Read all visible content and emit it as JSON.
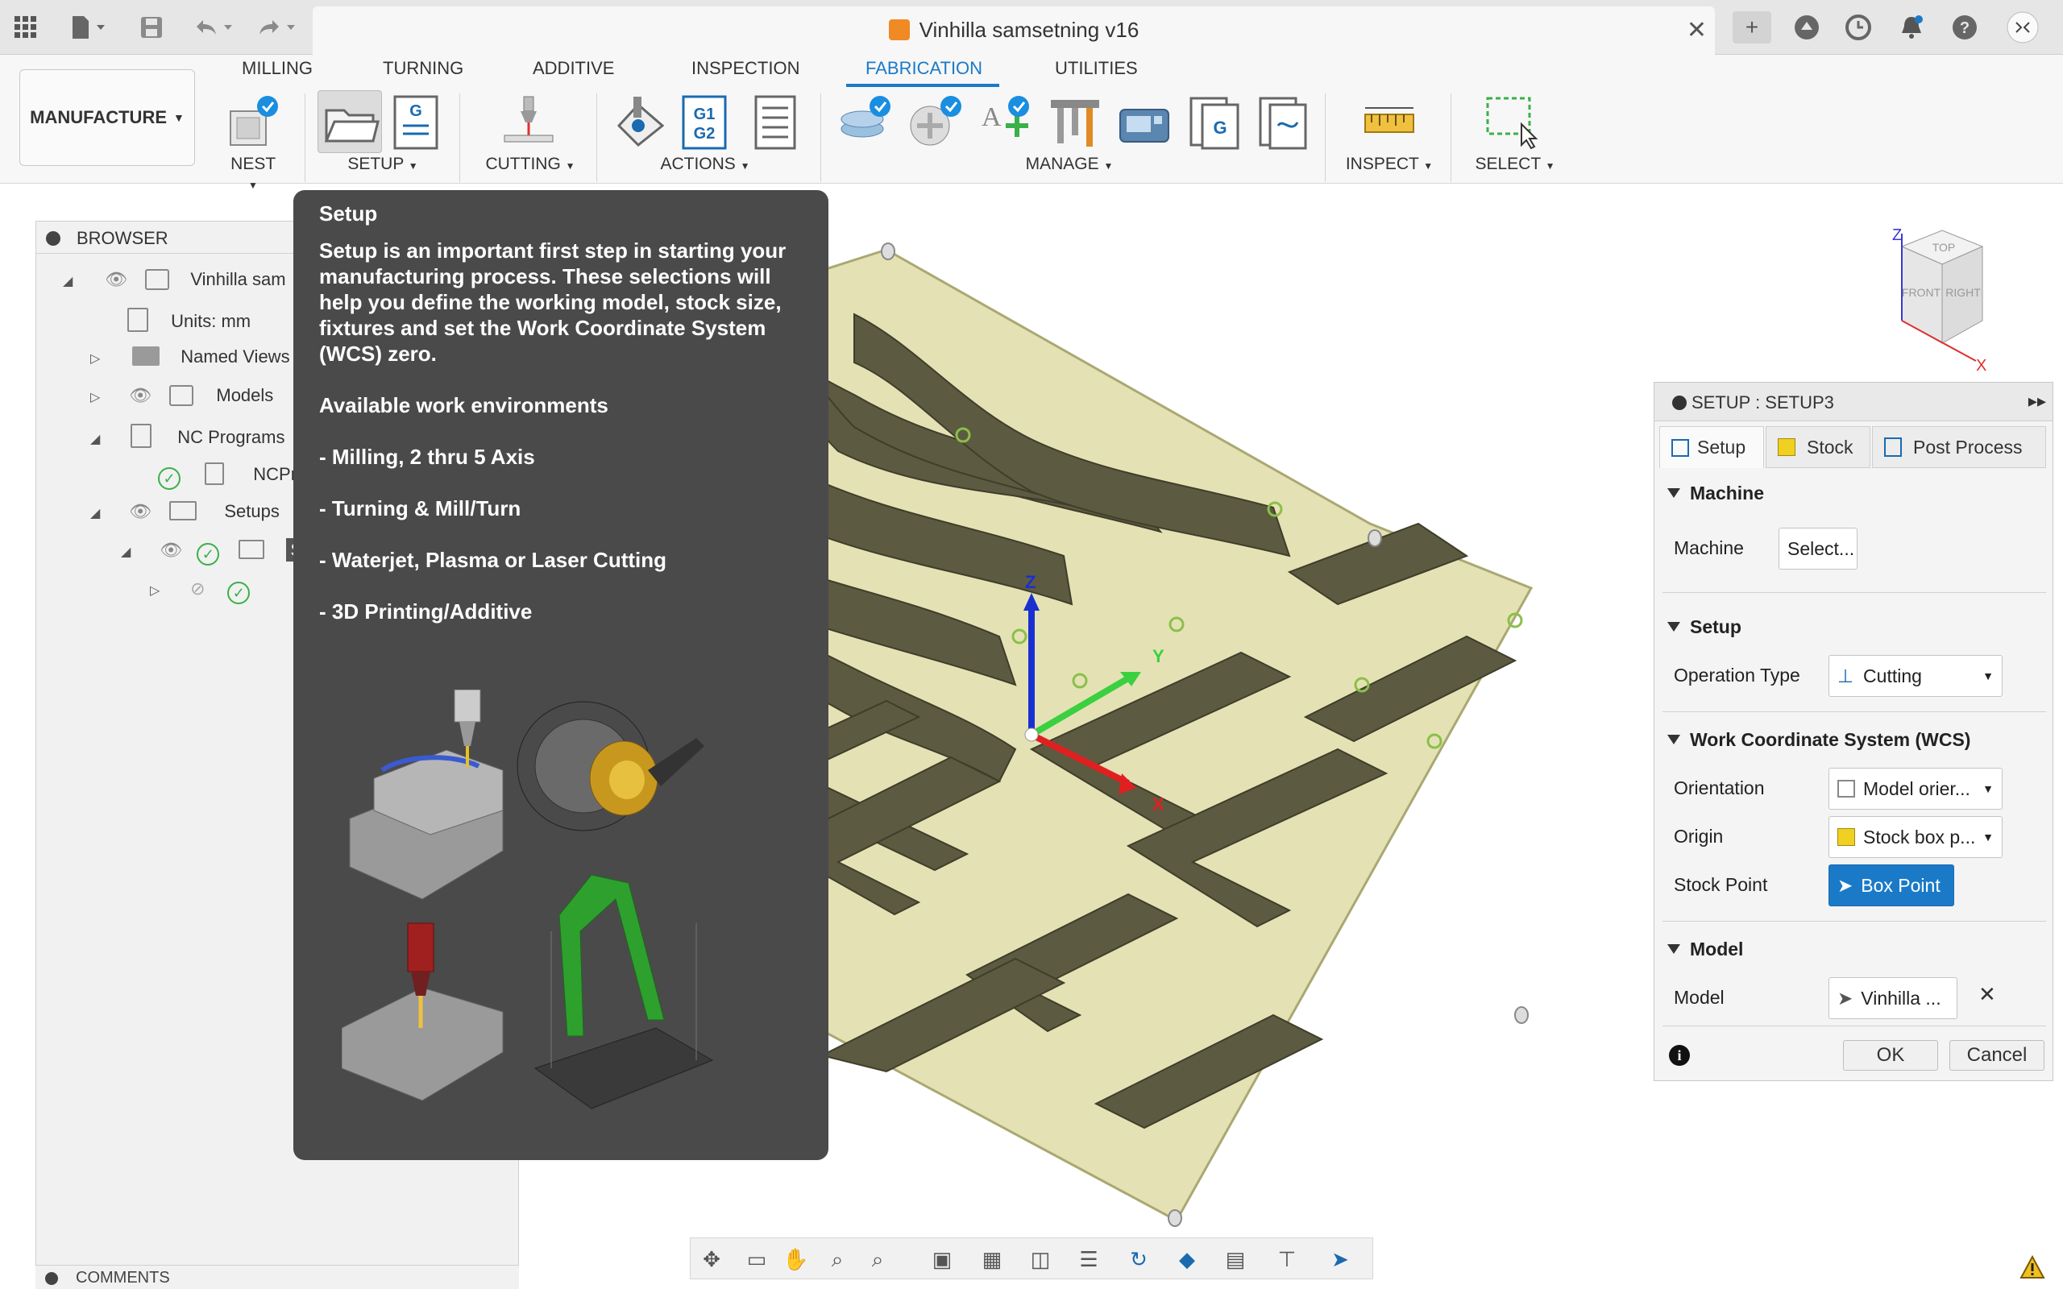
{
  "titlebar": {
    "doc_title": "Vinhilla samsetning v16",
    "close_symbol": "✕",
    "add_symbol": "+"
  },
  "toolbar": {
    "workspace": "MANUFACTURE",
    "tabs": [
      {
        "label": "MILLING"
      },
      {
        "label": "TURNING"
      },
      {
        "label": "ADDITIVE"
      },
      {
        "label": "INSPECTION"
      },
      {
        "label": "FABRICATION"
      },
      {
        "label": "UTILITIES"
      }
    ],
    "active_tab": "FABRICATION",
    "groups": {
      "nest": "NEST",
      "setup": "SETUP",
      "cutting": "CUTTING",
      "actions": "ACTIONS",
      "manage": "MANAGE",
      "inspect": "INSPECT",
      "select": "SELECT"
    },
    "g1g2_label": "G1 G2",
    "g_label": "G"
  },
  "browser": {
    "title": "BROWSER",
    "items": [
      {
        "label": "Vinhilla sam"
      },
      {
        "label": "Units: mm"
      },
      {
        "label": "Named Views"
      },
      {
        "label": "Models"
      },
      {
        "label": "NC Programs"
      },
      {
        "label": "NCPro"
      },
      {
        "label": "Setups"
      },
      {
        "label": "S"
      }
    ],
    "comments": "COMMENTS"
  },
  "tooltip": {
    "title": "Setup",
    "description": "Setup is an important first step in starting your manufacturing process. These selections will help you define the working model, stock size, fixtures and set the Work Coordinate System (WCS) zero.",
    "environments_heading": "Available work environments",
    "environments": [
      "- Milling, 2 thru 5 Axis",
      "- Turning & Mill/Turn",
      "- Waterjet, Plasma or Laser Cutting",
      "- 3D Printing/Additive"
    ]
  },
  "viewcube": {
    "top": "TOP",
    "front": "FRONT",
    "right": "RIGHT",
    "z": "Z",
    "x": "X"
  },
  "axes": {
    "z": "Z",
    "y": "Y",
    "x": "X"
  },
  "setup_panel": {
    "title": "SETUP : SETUP3",
    "tabs": [
      {
        "label": "Setup"
      },
      {
        "label": "Stock"
      },
      {
        "label": "Post Process"
      }
    ],
    "sections": {
      "machine": "Machine",
      "setup": "Setup",
      "wcs": "Work Coordinate System (WCS)",
      "model": "Model"
    },
    "fields": {
      "machine_label": "Machine",
      "machine_value": "Select...",
      "operation_type_label": "Operation Type",
      "operation_type_value": "Cutting",
      "orientation_label": "Orientation",
      "orientation_value": "Model orier...",
      "origin_label": "Origin",
      "origin_value": "Stock box p...",
      "stock_point_label": "Stock Point",
      "stock_point_value": "Box Point",
      "model_label": "Model",
      "model_value": "Vinhilla ..."
    },
    "ok": "OK",
    "cancel": "Cancel",
    "info_symbol": "i"
  },
  "colors": {
    "accent": "#1a7ac8",
    "tooltip_bg": "#4a4a4a",
    "board": "#e4e2b4",
    "parts": "#5c5a40",
    "stock_point_btn": "#1a7ac8"
  }
}
